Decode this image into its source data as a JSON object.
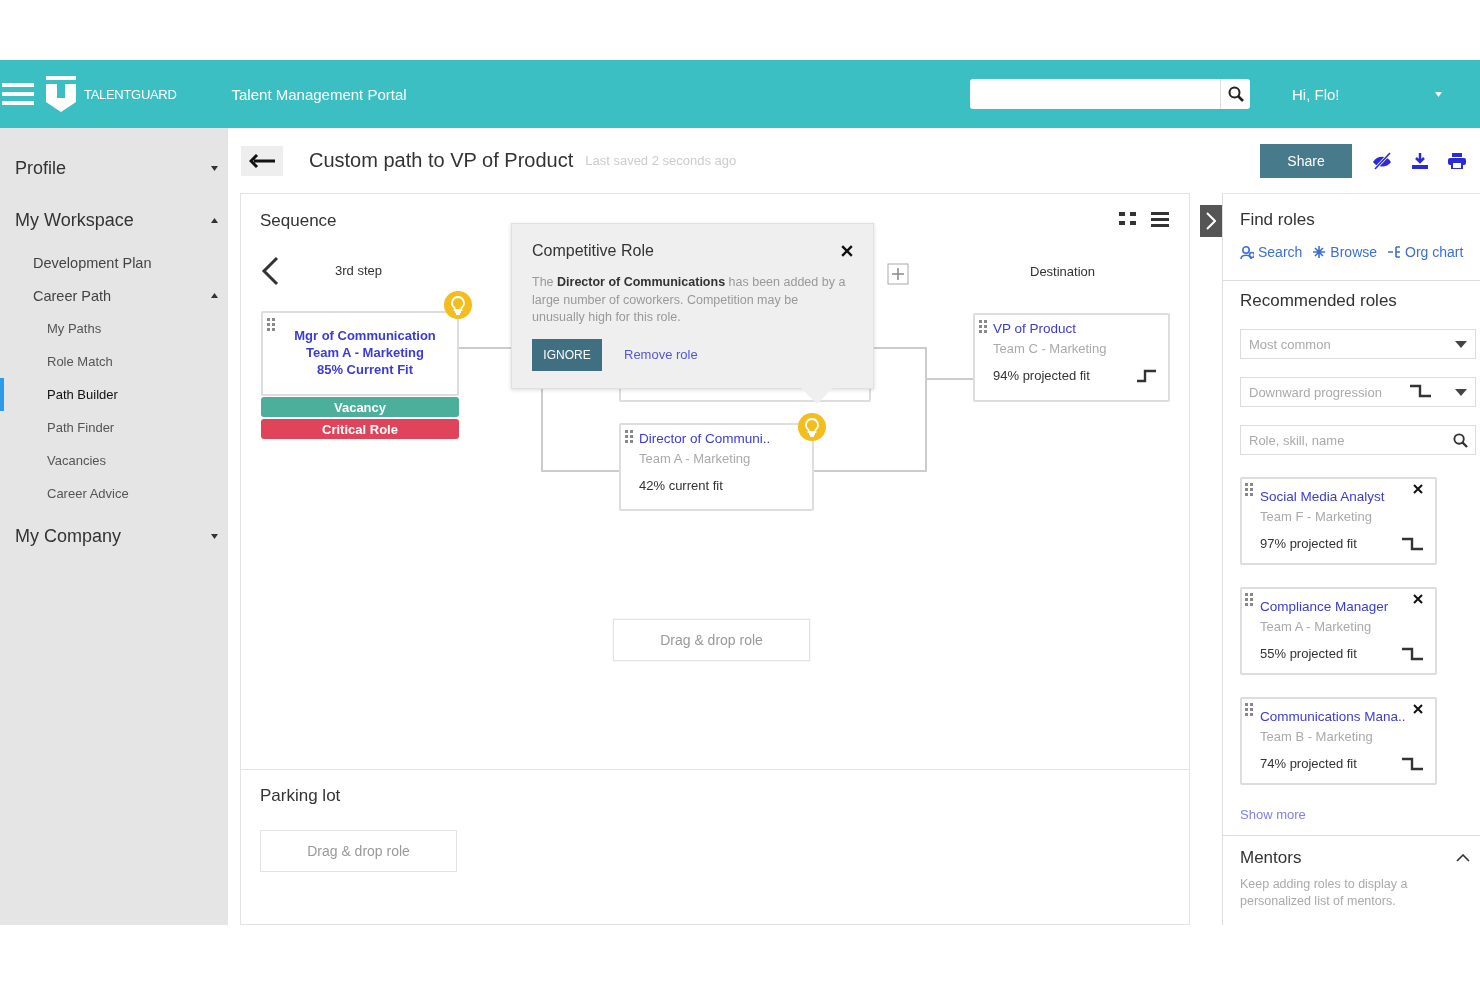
{
  "header": {
    "brand": "TALENTGUARD",
    "portal": "Talent Management Portal",
    "greeting": "Hi, Flo!"
  },
  "sidebar": {
    "items": [
      {
        "label": "Profile",
        "expanded": false,
        "selected": false
      },
      {
        "label": "My Workspace",
        "expanded": true,
        "selected": false,
        "children": [
          {
            "label": "Development Plan",
            "selected": false
          },
          {
            "label": "Career Path",
            "expanded": true,
            "selected": false,
            "children": [
              {
                "label": "My Paths",
                "selected": false
              },
              {
                "label": "Role Match",
                "selected": false
              },
              {
                "label": "Path Builder",
                "selected": true
              },
              {
                "label": "Path Finder",
                "selected": false
              },
              {
                "label": "Vacancies",
                "selected": false
              },
              {
                "label": "Career Advice",
                "selected": false
              }
            ]
          }
        ]
      },
      {
        "label": "My Company",
        "expanded": false,
        "selected": false
      }
    ]
  },
  "toolbar": {
    "title": "Custom path to VP of Product",
    "saved": "Last saved 2 seconds ago",
    "share": "Share"
  },
  "sequence": {
    "title": "Sequence",
    "step_label": "3rd step",
    "destination_label": "Destination",
    "drop_label": "Drag & drop role",
    "nodes": [
      {
        "kind": "current",
        "title": "Mgr of Communication",
        "team": "Team A - Marketing",
        "fit": "85% Current Fit",
        "tip": true,
        "tags": [
          {
            "label": "Vacancy",
            "color": "#4caf9c"
          },
          {
            "label": "Critical Role",
            "color": "#e0445a"
          }
        ]
      },
      {
        "kind": "step",
        "title": "Director of Communi..",
        "team": "Team A - Marketing",
        "fit": "42% current fit",
        "tip": true
      },
      {
        "kind": "step",
        "title": "VP of Product",
        "team": "Team C - Marketing",
        "fit": "94% projected fit",
        "tip": false,
        "rising": true
      }
    ],
    "popover": {
      "title": "Competitive Role",
      "text": "The **Director of Communications** has been added by a large number of coworkers. Competition may be unusually high for this role.",
      "ignore": "IGNORE",
      "remove": "Remove role"
    }
  },
  "parking": {
    "title": "Parking lot",
    "drop_label": "Drag & drop role"
  },
  "find_roles": {
    "title": "Find roles",
    "links": [
      "Search",
      "Browse",
      "Org chart"
    ]
  },
  "recommended": {
    "title": "Recommended roles",
    "sort": "Most common",
    "direction": "Downward progression",
    "direction_rising": false,
    "search_placeholder": "Role, skill, name",
    "roles": [
      {
        "title": "Social Media Analyst",
        "team": "Team F - Marketing",
        "fit": "97% projected fit",
        "rising": false
      },
      {
        "title": "Compliance Manager",
        "team": "Team A - Marketing",
        "fit": "55% projected fit",
        "rising": false
      },
      {
        "title": "Communications Mana..",
        "team": "Team B - Marketing",
        "fit": "74% projected fit",
        "rising": false
      }
    ],
    "show_more": "Show more"
  },
  "mentors": {
    "title": "Mentors",
    "expanded": true,
    "text": "Keep adding roles to display a personalized list of mentors."
  }
}
